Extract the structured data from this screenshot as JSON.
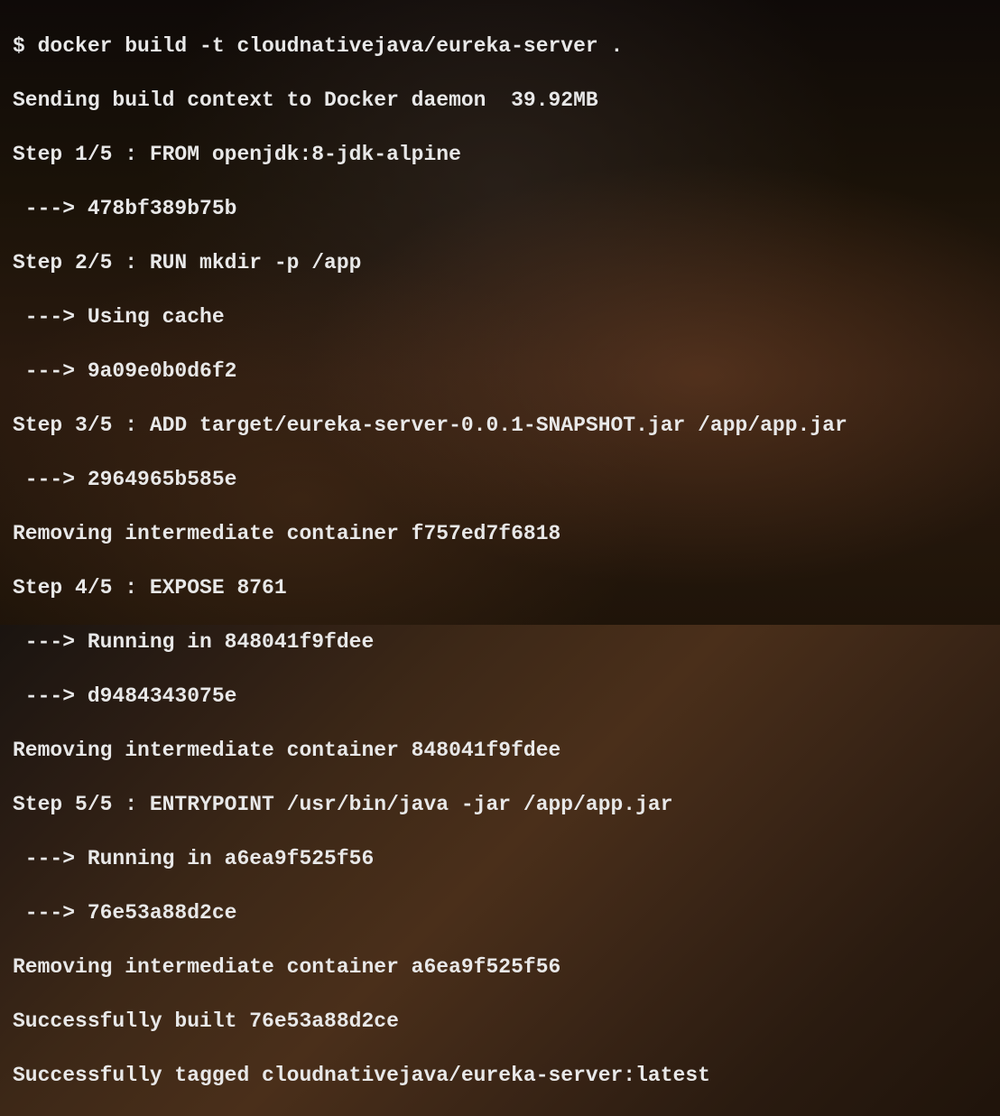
{
  "terminal": {
    "prompt": "$ ",
    "command": "docker build -t cloudnativejava/eureka-server .",
    "lines": [
      "Sending build context to Docker daemon  39.92MB",
      "Step 1/5 : FROM openjdk:8-jdk-alpine",
      " ---> 478bf389b75b",
      "Step 2/5 : RUN mkdir -p /app",
      " ---> Using cache",
      " ---> 9a09e0b0d6f2",
      "Step 3/5 : ADD target/eureka-server-0.0.1-SNAPSHOT.jar /app/app.jar",
      " ---> 2964965b585e",
      "Removing intermediate container f757ed7f6818",
      "Step 4/5 : EXPOSE 8761",
      " ---> Running in 848041f9fdee",
      " ---> d9484343075e",
      "Removing intermediate container 848041f9fdee",
      "Step 5/5 : ENTRYPOINT /usr/bin/java -jar /app/app.jar",
      " ---> Running in a6ea9f525f56",
      " ---> 76e53a88d2ce",
      "Removing intermediate container a6ea9f525f56",
      "Successfully built 76e53a88d2ce",
      "Successfully tagged cloudnativejava/eureka-server:latest"
    ]
  }
}
